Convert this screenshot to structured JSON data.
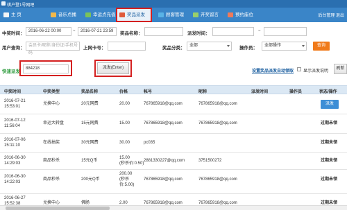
{
  "app": {
    "title": "棋户登1号网吧"
  },
  "nav": {
    "items": [
      {
        "label": "主 页",
        "color": "#f5f5f5"
      },
      {
        "label": "音乐点播",
        "color": "#f2b84b"
      },
      {
        "label": "幸运点充值",
        "color": "#7bc35a"
      },
      {
        "label": "奖品派发",
        "color": "#e05a3a"
      },
      {
        "label": "顾客管理",
        "color": "#59b3e6"
      },
      {
        "label": "开奖留言",
        "color": "#9ad06a"
      },
      {
        "label": "预约座位",
        "color": "#f07a5a"
      }
    ],
    "right": "后台管理 退出"
  },
  "filters": {
    "win_time_label": "中奖时间：",
    "start_time": "2016-06-22 00:00",
    "range_sep": "~",
    "end_time": "2016-07-21 23:59",
    "prize_name_label": "奖品名称：",
    "award_time_label": "派发时间：",
    "award_time_sep": "~",
    "user_query_label": "用户查询：",
    "user_query_placeholder": "会员卡/昵称/身份证/手机号码",
    "card_label": "上网卡号：",
    "prize_cat_label": "奖品分类：",
    "prize_cat_value": "全部",
    "operator_label": "操作员：",
    "operator_value": "全部操作",
    "query_button": "查询"
  },
  "quick": {
    "label": "快速派发",
    "code": "884218",
    "button": "派发(Enter)",
    "link": "设置奖品派发自动领取",
    "checkbox_label": "显示派发说明",
    "refresh": "刷新"
  },
  "table": {
    "headers": [
      "中奖时间",
      "中奖类型",
      "奖品名称",
      "价格",
      "帐号",
      "昵称",
      "派发时间",
      "操作员",
      "状态/操作"
    ],
    "rows": [
      {
        "time": [
          "2016-07-21",
          "15:53:01"
        ],
        "type": "兑换中心",
        "prize": "20元网费",
        "price": [
          "20.00"
        ],
        "account": "767865918@qq.com",
        "nick": "767865918@qq.com",
        "status": "派发",
        "is_button": true
      },
      {
        "time": [
          "2016-07-12",
          "11:56:04"
        ],
        "type": "幸运大转盘",
        "prize": "15元网费",
        "price": [
          "15.00"
        ],
        "account": "767865918@qq.com",
        "nick": "767865918@qq.com",
        "status": "过期未领",
        "is_button": false
      },
      {
        "time": [
          "2016-07-06",
          "15:11:10"
        ],
        "type": "在线抽奖",
        "prize": "30元网费",
        "price": [
          "30.00"
        ],
        "account": "pc035",
        "nick": "",
        "status": "过期未领",
        "is_button": false
      },
      {
        "time": [
          "2016-06-30",
          "14:29:03"
        ],
        "type": "商品秒杀",
        "prize": "15元Q币",
        "price": [
          "15.00",
          "(秒杀价:0.50)"
        ],
        "account": "2881330227@qq.com",
        "nick": "3751500272",
        "status": "过期未领",
        "is_button": false
      },
      {
        "time": [
          "2016-06-30",
          "14:22:03"
        ],
        "type": "商品秒杀",
        "prize": "200元Q币",
        "price": [
          "200.00",
          "(秒杀价:5.00)"
        ],
        "account": "767865918@qq.com",
        "nick": "767865918@qq.com",
        "status": "过期未领",
        "is_button": false
      },
      {
        "time": [
          "2016-06-27",
          "15:52:38"
        ],
        "type": "兑换中心",
        "prize": "佛肠",
        "price": [
          "2.00"
        ],
        "account": "767865918@qq.com",
        "nick": "767865918@qq.com",
        "status": "过期未领",
        "is_button": false
      }
    ]
  }
}
